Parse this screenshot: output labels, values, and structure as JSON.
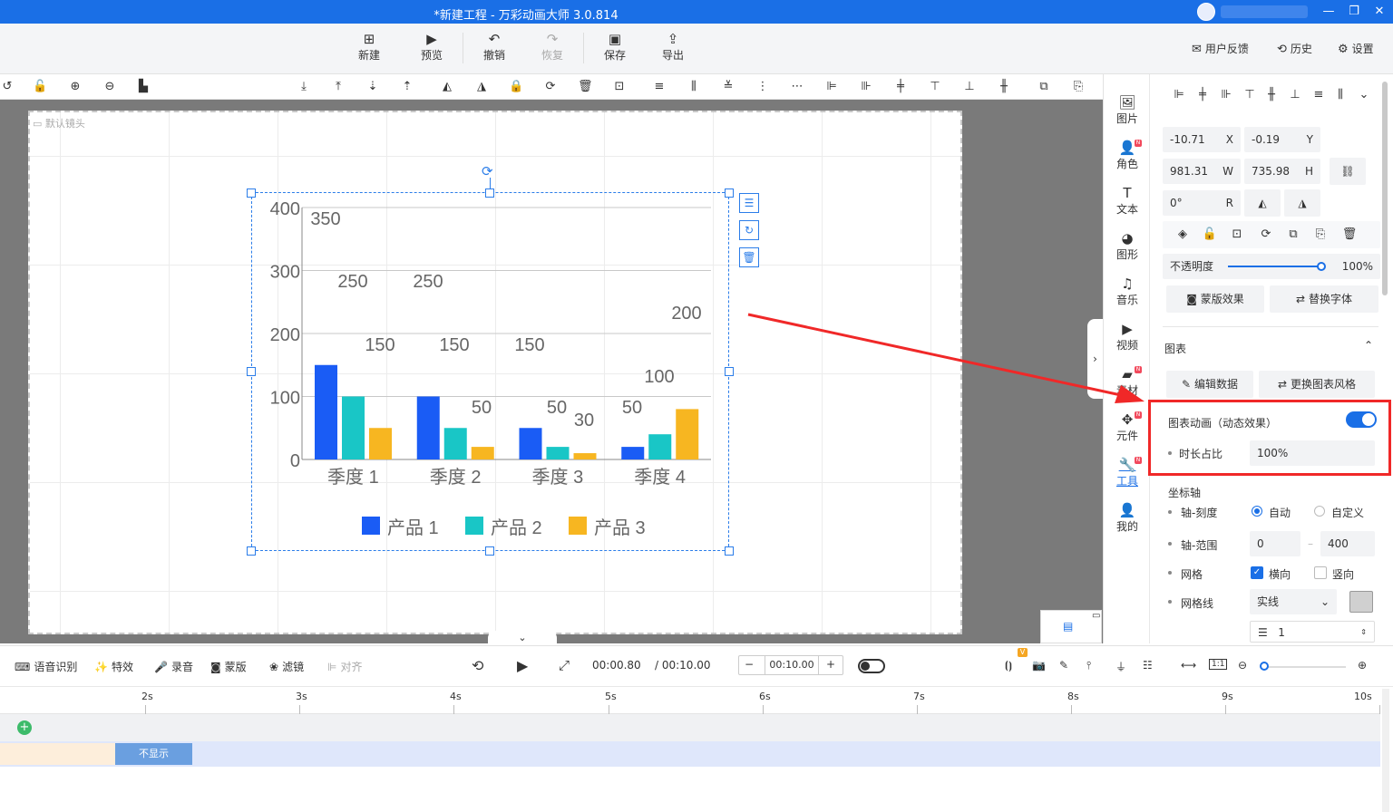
{
  "window": {
    "title": "*新建工程 - 万彩动画大师 3.0.814"
  },
  "toolbar": {
    "new": "新建",
    "preview": "预览",
    "undo": "撤销",
    "redo": "恢复",
    "save": "保存",
    "export": "导出",
    "feedback": "用户反馈",
    "history": "历史",
    "settings": "设置"
  },
  "canvas": {
    "camera_label": "默认镜头"
  },
  "chart_data": {
    "type": "bar",
    "categories": [
      "季度 1",
      "季度 2",
      "季度 3",
      "季度 4"
    ],
    "series": [
      {
        "name": "产品 1",
        "values": [
          150,
          100,
          50,
          20
        ],
        "color": "#1a5cf5"
      },
      {
        "name": "产品 2",
        "values": [
          100,
          50,
          20,
          40
        ],
        "color": "#19c6c6"
      },
      {
        "name": "产品 3",
        "values": [
          50,
          20,
          10,
          80
        ],
        "color": "#f7b621"
      }
    ],
    "yticks": [
      0,
      100,
      200,
      300,
      400
    ],
    "ylim": [
      0,
      400
    ],
    "grid": "horizontal",
    "legend": "bottom",
    "floating_labels": [
      "350",
      "250",
      "250",
      "150",
      "150",
      "150",
      "200",
      "50",
      "50",
      "30",
      "50",
      "100"
    ]
  },
  "rightstrip": {
    "items": [
      {
        "label": "图片",
        "icon": "image-icon"
      },
      {
        "label": "角色",
        "icon": "character-icon"
      },
      {
        "label": "文本",
        "icon": "text-icon"
      },
      {
        "label": "图形",
        "icon": "shape-icon"
      },
      {
        "label": "音乐",
        "icon": "music-icon"
      },
      {
        "label": "视频",
        "icon": "video-icon"
      },
      {
        "label": "素材",
        "icon": "material-icon"
      },
      {
        "label": "元件",
        "icon": "component-icon"
      },
      {
        "label": "工具",
        "icon": "tool-icon"
      },
      {
        "label": "我的",
        "icon": "user-icon"
      }
    ],
    "badge": "N"
  },
  "panel": {
    "x": "-10.71",
    "y": "-0.19",
    "w": "981.31",
    "h": "735.98",
    "r": "0°",
    "x_suffix": "X",
    "y_suffix": "Y",
    "w_suffix": "W",
    "h_suffix": "H",
    "r_suffix": "R",
    "opacity_label": "不透明度",
    "opacity_value": "100%",
    "opacity_fraction": 1.0,
    "mask_button": "蒙版效果",
    "replace_font_button": "替换字体",
    "chart_section": "图表",
    "edit_data_button": "编辑数据",
    "change_style_button": "更换图表风格",
    "chart_anim_label": "图表动画（动态效果）",
    "chart_anim_on": true,
    "duration_label": "时长占比",
    "duration_value": "100%",
    "axis_section": "坐标轴",
    "axis_scale_label": "轴-刻度",
    "auto_label": "自动",
    "custom_label": "自定义",
    "axis_range_label": "轴-范围",
    "range_min": "0",
    "range_max": "400",
    "range_sep": "–",
    "grid_label": "网格",
    "horizontal_label": "横向",
    "vertical_label": "竖向",
    "gridline_label": "网格线",
    "gridline_value": "实线",
    "line_width": "1"
  },
  "timeline": {
    "speech": "语音识别",
    "effects": "特效",
    "record": "录音",
    "mask": "蒙版",
    "filter": "滤镜",
    "align": "对齐",
    "current_time": "00:00.80",
    "total_time": "/ 00:10.00",
    "step_time": "00:10.00",
    "ruler": [
      "2s",
      "3s",
      "4s",
      "5s",
      "6s",
      "7s",
      "8s",
      "9s",
      "10s"
    ],
    "clip_label": "不显示",
    "badge_v": "V"
  }
}
